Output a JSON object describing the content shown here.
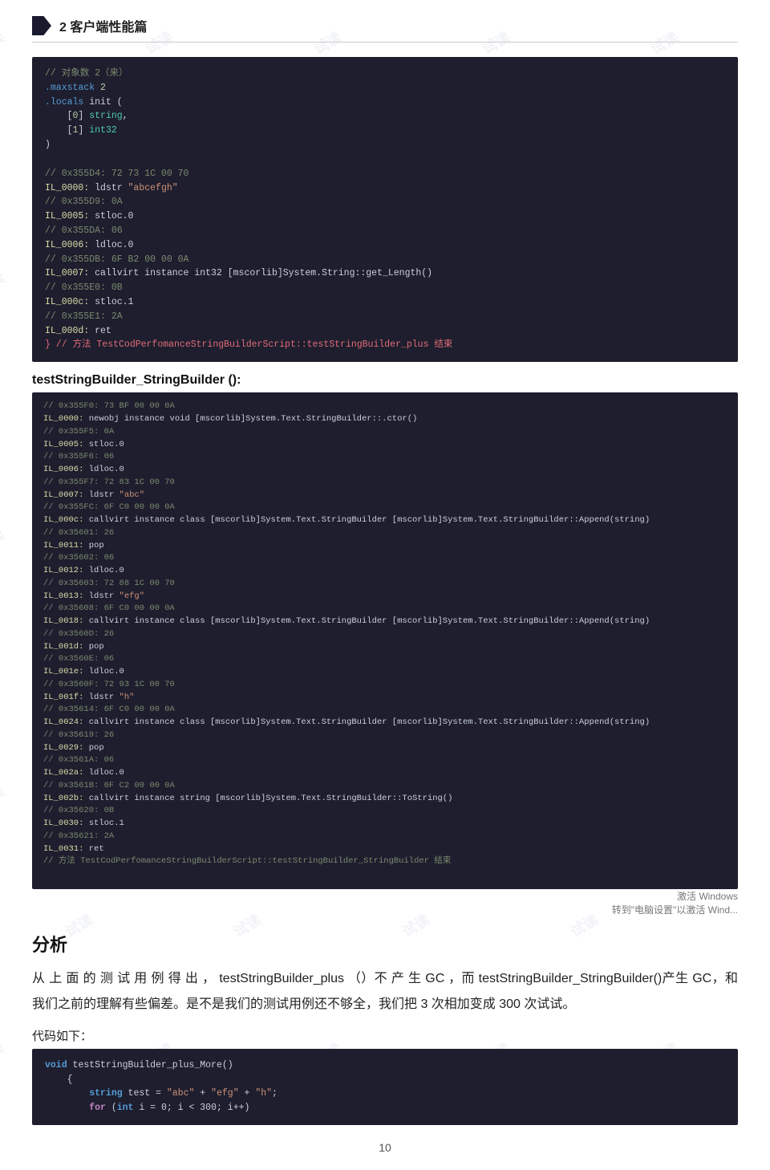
{
  "chapter": {
    "number": "2",
    "title": "2 客户端性能篇"
  },
  "code_block_1": {
    "lines": [
      "// 对象数 2（来）",
      ".maxstack 2",
      ".locals init (",
      "    [0] string,",
      "    [1] int32",
      ")",
      "",
      "// 0x355D4: 72 73 1C 00 70",
      "IL_0000: ldstr \"abcefgh\"",
      "// 0x355D9: 0A",
      "IL_0005: stloc.0",
      "// 0x355DA: 06",
      "IL_0006: ldloc.0",
      "// 0x355DB: 6F B2 00 00 0A",
      "IL_0007: callvirt instance int32 [mscorlib]System.String::get_Length()",
      "// 0x355E0: 0B",
      "IL_000c: stloc.1",
      "// 0x355E1: 2A",
      "IL_000d: ret",
      "} // 方法 TestCodPerfomanceStringBuilderScript::testStringBuilder_plus 结束"
    ]
  },
  "func_title_2": "testStringBuilder_StringBuilder ():",
  "code_block_2": {
    "lines": [
      "// 0x355F0: 73 BF 00 00 0A",
      "IL_0000: newobj instance void [mscorlib]System.Text.StringBuilder::.ctor()",
      "// 0x355F5: 0A",
      "IL_0005: stloc.0",
      "// 0x355F6: 06",
      "IL_0006: ldloc.0",
      "// 0x355F7: 72 83 1C 00 70",
      "IL_0007: ldstr \"abc\"",
      "// 0x355FC: 6F C0 00 00 0A",
      "IL_000c: callvirt instance class [mscorlib]System.Text.StringBuilder [mscorlib]System.Text.StringBuilder::Append(string)",
      "// 0x35601: 26",
      "IL_0011: pop",
      "// 0x35602: 06",
      "IL_0012: ldloc.0",
      "// 0x35603: 72 88 1C 00 70",
      "IL_0013: ldstr \"efg\"",
      "// 0x35608: 6F C0 00 00 0A",
      "IL_0018: callvirt instance class [mscorlib]System.Text.StringBuilder [mscorlib]System.Text.StringBuilder::Append(string)",
      "// 0x3560D: 26",
      "IL_001d: pop",
      "// 0x3560E: 06",
      "IL_001e: ldloc.0",
      "// 0x3560F: 72 93 1C 00 70",
      "IL_001f: ldstr \"h\"",
      "// 0x35614: 6F C0 00 00 0A",
      "IL_0024: callvirt instance class [mscorlib]System.Text.StringBuilder [mscorlib]System.Text.StringBuilder::Append(string)",
      "// 0x35619: 26",
      "IL_0029: pop",
      "// 0x3561A: 06",
      "IL_002a: ldloc.0",
      "// 0x3561B: 6F C2 00 00 0A",
      "IL_002b: callvirt instance string [mscorlib]System.Text.StringBuilder::ToString()",
      "// 0x35620: 0B",
      "IL_0030: stloc.1",
      "// 0x35621: 2A",
      "IL_0031: ret",
      "// 方法 TestCodPerfomanceStringBuilderScript::testStringBuilder_StringBuilder 结束"
    ]
  },
  "section_heading": "分析",
  "body_text_1": "从 上 面 的 测 试 用 例 得 出 ， testStringBuilder_plus （）不 产 生  GC ，而 testStringBuilder_StringBuilder()产生 GC，和我们之前的理解有些偏差。是不是我们的测试用例还不够全，我们把 3 次相加变成 300 次试试。",
  "label_code": "代码如下：",
  "code_block_3_lines": [
    "void testStringBuilder_plus_More()",
    "{",
    "    string test = \"abc\" + \"efg\" + \"h\";",
    "    for (int i = 0; i < 300; i++)"
  ],
  "page_number": "10",
  "win_activate_line1": "激活 Windows",
  "win_activate_line2": "转到\"电脑设置\"以激活 Wind..."
}
